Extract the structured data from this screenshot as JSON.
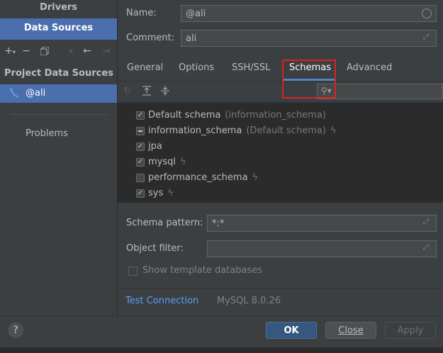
{
  "sidebar": {
    "drivers_label": "Drivers",
    "data_sources_label": "Data Sources",
    "project_data_sources_label": "Project Data Sources",
    "selected_source": "@ali",
    "problems_label": "Problems"
  },
  "form": {
    "name_label": "Name:",
    "name_value": "@ali",
    "comment_label": "Comment:",
    "comment_value": "ali"
  },
  "tabs": [
    {
      "label": "General"
    },
    {
      "label": "Options"
    },
    {
      "label": "SSH/SSL"
    },
    {
      "label": "Schemas"
    },
    {
      "label": "Advanced"
    }
  ],
  "active_tab": "Schemas",
  "schemas": [
    {
      "name": "Default schema",
      "hint": "(information_schema)",
      "state": "checked",
      "bolt": false
    },
    {
      "name": "information_schema",
      "hint": "(Default schema)",
      "state": "partial",
      "bolt": true
    },
    {
      "name": "jpa",
      "hint": "",
      "state": "checked",
      "bolt": false
    },
    {
      "name": "mysql",
      "hint": "",
      "state": "checked",
      "bolt": true
    },
    {
      "name": "performance_schema",
      "hint": "",
      "state": "unchecked",
      "bolt": true
    },
    {
      "name": "sys",
      "hint": "",
      "state": "checked",
      "bolt": true
    }
  ],
  "schema_pattern_label": "Schema pattern:",
  "schema_pattern_value": "*:*",
  "object_filter_label": "Object filter:",
  "object_filter_value": "",
  "show_template_label": "Show template databases",
  "test_connection_label": "Test Connection",
  "mysql_version": "MySQL 8.0.26",
  "buttons": {
    "help": "?",
    "ok": "OK",
    "close": "Close",
    "apply": "Apply"
  },
  "colors": {
    "accent": "#4b6eaf",
    "highlight_box": "#e02020",
    "link": "#589df6"
  }
}
